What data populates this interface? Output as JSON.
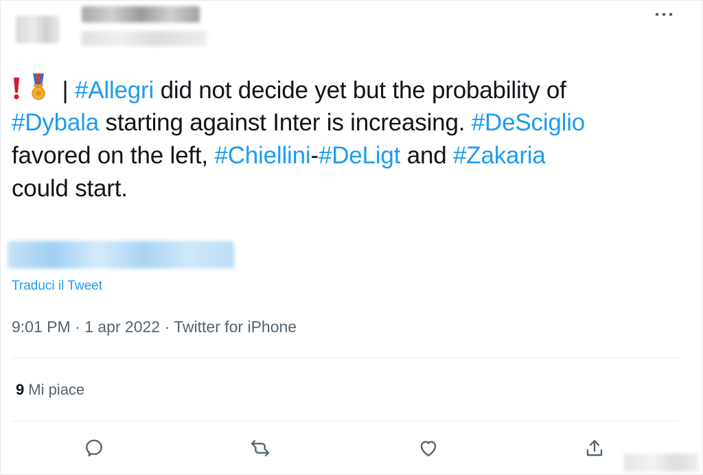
{
  "tweet": {
    "text_lines": [
      [
        {
          "kind": "emoji",
          "icon": "exclamation-mark-icon"
        },
        {
          "kind": "emoji",
          "icon": "military-medal-icon"
        },
        {
          "kind": "text",
          "value": " | "
        },
        {
          "kind": "tag",
          "value": "#Allegri"
        },
        {
          "kind": "text",
          "value": " did not decide yet but the probability of"
        }
      ],
      [
        {
          "kind": "tag",
          "value": "#Dybala"
        },
        {
          "kind": "text",
          "value": " starting against Inter is increasing. "
        },
        {
          "kind": "tag",
          "value": "#DeSciglio"
        }
      ],
      [
        {
          "kind": "text",
          "value": "favored on the left, "
        },
        {
          "kind": "tag",
          "value": "#Chiellini"
        },
        {
          "kind": "text",
          "value": "-"
        },
        {
          "kind": "tag",
          "value": "#DeLigt"
        },
        {
          "kind": "text",
          "value": " and "
        },
        {
          "kind": "tag",
          "value": "#Zakaria"
        }
      ],
      [
        {
          "kind": "text",
          "value": "could start."
        }
      ]
    ],
    "translate_label": "Traduci il Tweet",
    "time": "9:01 PM",
    "separator": " · ",
    "date": "1 apr 2022",
    "source": "Twitter for iPhone",
    "likes_count": "9",
    "likes_label": "Mi piace"
  },
  "icons": {
    "more": "more-options-icon",
    "reply": "reply-icon",
    "retweet": "retweet-icon",
    "like": "like-icon",
    "share": "share-icon"
  },
  "colors": {
    "accent": "#1d9bf0",
    "text": "#0f1419",
    "secondary": "#536471",
    "divider": "#e6ecf0"
  }
}
